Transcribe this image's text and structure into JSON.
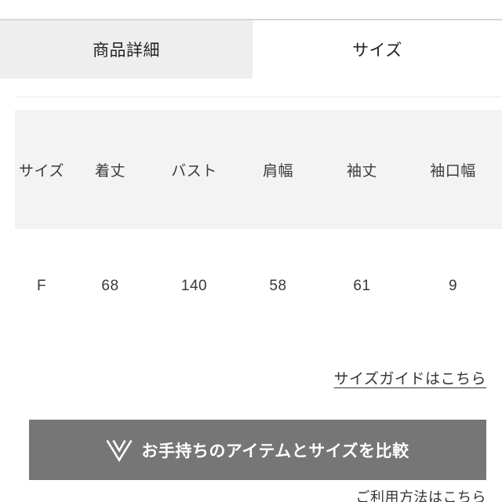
{
  "tabs": [
    {
      "label": "商品詳細",
      "active": false
    },
    {
      "label": "サイズ",
      "active": true
    }
  ],
  "size_table": {
    "headers": [
      "サイズ",
      "着丈",
      "バスト",
      "肩幅",
      "袖丈",
      "袖口幅"
    ],
    "rows": [
      [
        "F",
        "68",
        "140",
        "58",
        "61",
        "9"
      ]
    ]
  },
  "links": {
    "size_guide": "サイズガイドはこちら",
    "usage": "ご利用方法はこちら"
  },
  "compare_button": {
    "label": "お手持ちのアイテムとサイズを比較",
    "icon": "double-chevron-v-icon",
    "background_color": "#767676",
    "text_color": "#ffffff"
  },
  "colors": {
    "tab_inactive_bg": "#eeeeee",
    "tab_active_bg": "#ffffff",
    "table_header_bg": "#f3f3f3",
    "divider": "#ebebeb",
    "text": "#333333"
  }
}
